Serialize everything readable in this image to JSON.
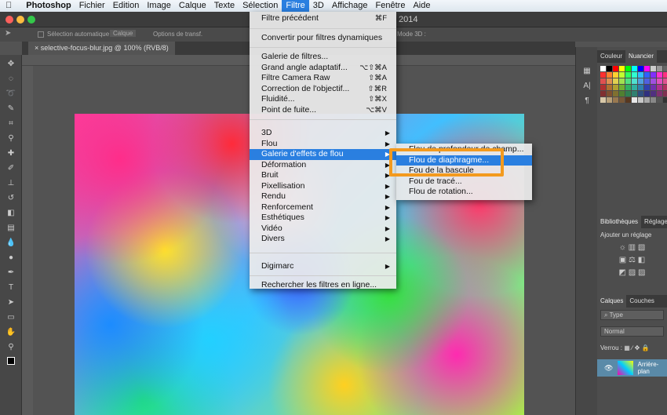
{
  "menubar": {
    "app": "Photoshop",
    "items": [
      "Fichier",
      "Edition",
      "Image",
      "Calque",
      "Texte",
      "Sélection",
      "Filtre",
      "3D",
      "Affichage",
      "Fenêtre",
      "Aide"
    ],
    "active": "Filtre"
  },
  "window": {
    "title_fragment": "2014"
  },
  "options": {
    "auto_select": "Sélection automatique :",
    "auto_select_value": "Calque",
    "transform": "Options de transf.",
    "mode3d": "Mode 3D :"
  },
  "document": {
    "tab": "selective-focus-blur.jpg @ 100% (RVB/8)"
  },
  "filter_menu": {
    "items": [
      {
        "label": "Filtre précédent",
        "shortcut": "⌘F"
      },
      {
        "label": "Convertir pour filtres dynamiques"
      },
      {
        "label": "Galerie de filtres..."
      },
      {
        "label": "Grand angle adaptatif...",
        "shortcut": "⌥⇧⌘A"
      },
      {
        "label": "Filtre Camera Raw",
        "shortcut": "⇧⌘A"
      },
      {
        "label": "Correction de l'objectif...",
        "shortcut": "⇧⌘R"
      },
      {
        "label": "Fluidité...",
        "shortcut": "⇧⌘X"
      },
      {
        "label": "Point de fuite...",
        "shortcut": "⌥⌘V"
      },
      {
        "label": "3D"
      },
      {
        "label": "Flou"
      },
      {
        "label": "Galerie d'effets de flou"
      },
      {
        "label": "Déformation"
      },
      {
        "label": "Bruit"
      },
      {
        "label": "Pixellisation"
      },
      {
        "label": "Rendu"
      },
      {
        "label": "Renforcement"
      },
      {
        "label": "Esthétiques"
      },
      {
        "label": "Vidéo"
      },
      {
        "label": "Divers"
      },
      {
        "label": "Digimarc"
      },
      {
        "label": "Rechercher les filtres en ligne..."
      }
    ]
  },
  "blur_submenu": {
    "items": [
      "Flou de profondeur de champ...",
      "Flou de diaphragme...",
      "Fou de la bascule",
      "Fou de tracé...",
      "Flou de rotation..."
    ],
    "selected": "Flou de diaphragme..."
  },
  "panels": {
    "color_tabs": [
      "Couleur",
      "Nuancier"
    ],
    "adjust_tabs": [
      "Bibliothèques",
      "Réglages"
    ],
    "adjust_label": "Ajouter un réglage",
    "layer_tabs": [
      "Calques",
      "Couches"
    ],
    "filter_type": "Type",
    "blend_mode": "Normal",
    "lock_label": "Verrou :",
    "layer_name": "Arrière-plan"
  },
  "colors": {
    "accent": "#2a7fe0",
    "highlight": "#f39a1e"
  }
}
